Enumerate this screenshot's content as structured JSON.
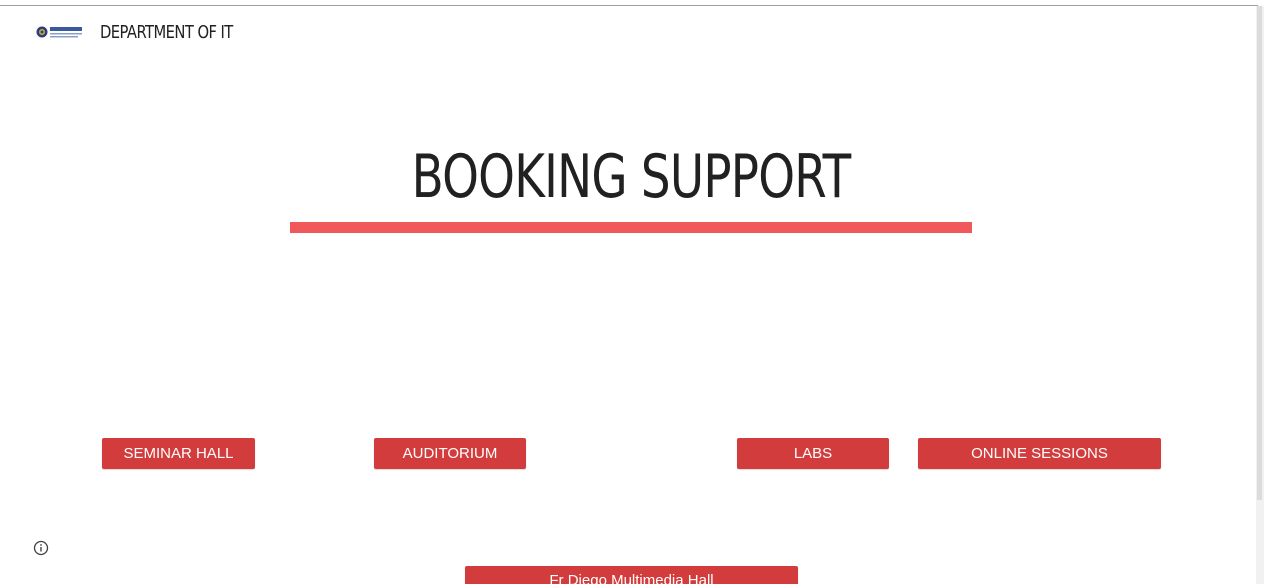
{
  "header": {
    "logo_icon": "university-logo-icon",
    "title": "DEPARTMENT OF IT"
  },
  "hero": {
    "title": "BOOKING SUPPORT",
    "underline_color": "#f0585a"
  },
  "buttons": {
    "seminar_hall": "SEMINAR HALL",
    "auditorium": "AUDITORIUM",
    "labs": "LABS",
    "online_sessions": "ONLINE SESSIONS",
    "multimedia_hall": "Fr Diego Multimedia Hall"
  },
  "colors": {
    "button_bg": "#d23c3c",
    "accent": "#f0585a"
  },
  "icons": {
    "info": "info-icon"
  }
}
